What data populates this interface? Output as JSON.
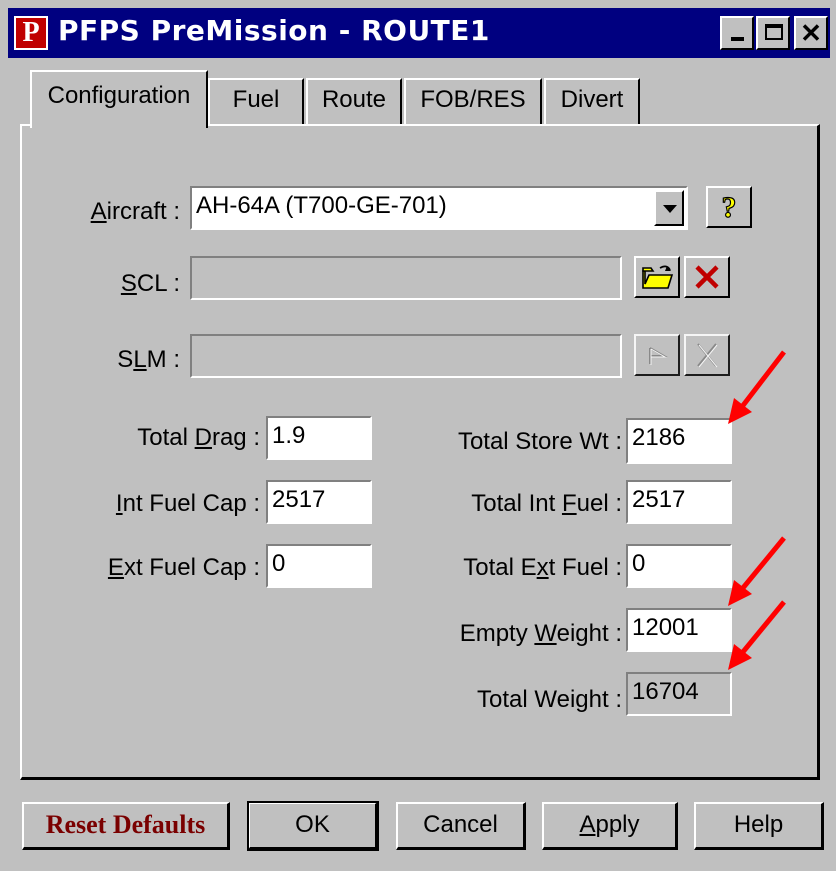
{
  "window": {
    "title": "PFPS PreMission - ROUTE1",
    "app_icon_letter": "P"
  },
  "tabs": [
    {
      "label": "Configuration",
      "active": true
    },
    {
      "label": "Fuel",
      "active": false
    },
    {
      "label": "Route",
      "active": false
    },
    {
      "label": "FOB/RES",
      "active": false
    },
    {
      "label": "Divert",
      "active": false
    }
  ],
  "aircraft": {
    "label_ul": "A",
    "label_rest": "ircraft :",
    "value": "AH-64A (T700-GE-701)"
  },
  "scl": {
    "label_ul": "S",
    "label_rest": "CL :",
    "value": ""
  },
  "slm": {
    "label_pre": "S",
    "label_ul": "L",
    "label_rest": "M :",
    "value": ""
  },
  "left_fields": {
    "total_drag": {
      "label_pre": "Total ",
      "label_ul": "D",
      "label_rest": "rag :",
      "value": "1.9"
    },
    "int_fuel_cap": {
      "label_pre": "",
      "label_ul": "I",
      "label_rest": "nt Fuel Cap :",
      "value": "2517"
    },
    "ext_fuel_cap": {
      "label_pre": "",
      "label_ul": "E",
      "label_rest": "xt Fuel Cap :",
      "value": "0"
    }
  },
  "right_fields": {
    "total_store_wt": {
      "label": "Total Store Wt :",
      "value": "2186"
    },
    "total_int_fuel": {
      "label_pre": "Total Int ",
      "label_ul": "F",
      "label_rest": "uel :",
      "value": "2517"
    },
    "total_ext_fuel": {
      "label_pre": "Total E",
      "label_ul": "x",
      "label_rest": "t Fuel :",
      "value": "0"
    },
    "empty_weight": {
      "label_pre": "Empty ",
      "label_ul": "W",
      "label_rest": "eight :",
      "value": "12001"
    },
    "total_weight": {
      "label": "Total Weight :",
      "value": "16704"
    }
  },
  "buttons": {
    "reset": "Reset Defaults",
    "ok": "OK",
    "cancel": "Cancel",
    "apply_ul": "A",
    "apply_rest": "pply",
    "help": "Help"
  },
  "icons": [
    "help-question-icon",
    "open-folder-icon",
    "delete-x-icon",
    "slm-load-icon",
    "slm-clear-icon",
    "annotation-arrow-icon"
  ],
  "colors": {
    "title_bar": "#000080",
    "face": "#c0c0c0",
    "annotation_arrow": "#ff0000",
    "reset_text": "#7a0000"
  }
}
